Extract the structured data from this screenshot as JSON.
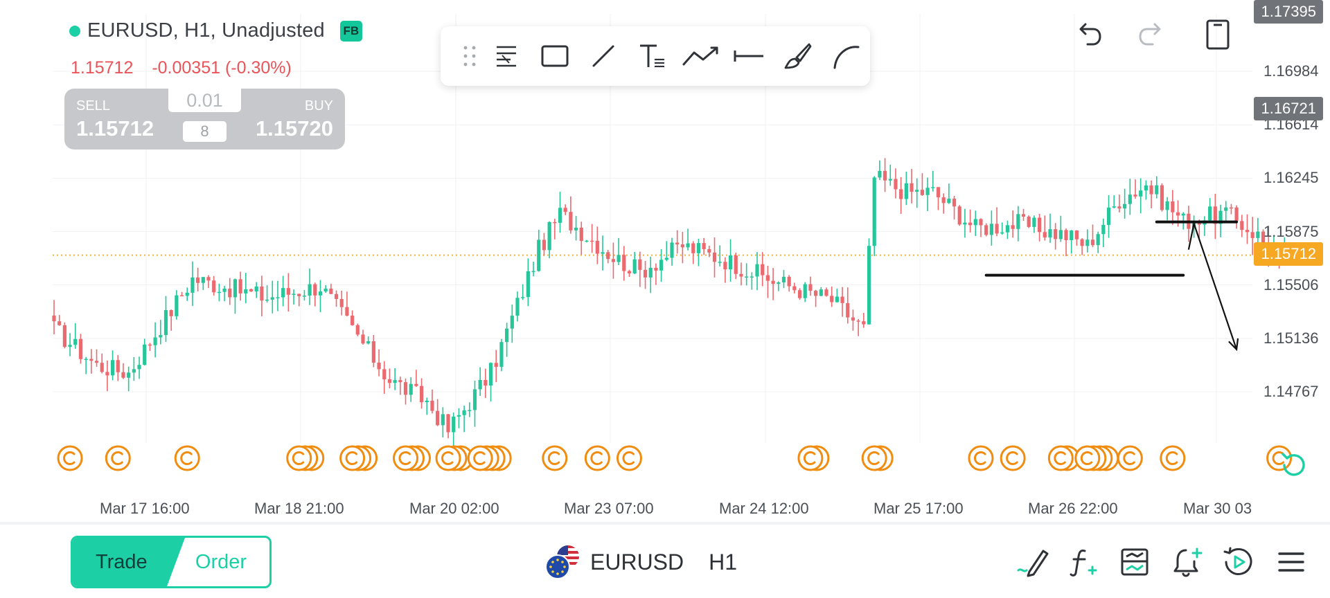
{
  "header": {
    "symbol_title": "EURUSD, H1, Unadjusted",
    "badge": "FB",
    "last_price": "1.15712",
    "change": "-0.00351 (-0.30%)"
  },
  "trade_panel": {
    "sell_label": "SELL",
    "sell_price": "1.15712",
    "buy_label": "BUY",
    "buy_price": "1.15720",
    "lot_value": "0.01",
    "spread": "8"
  },
  "drawing_tools": [
    "grip-icon",
    "fibonacci-icon",
    "rectangle-icon",
    "trendline-icon",
    "text-icon",
    "polyline-icon",
    "horizontal-line-icon",
    "brush-icon",
    "arc-icon"
  ],
  "top_actions": [
    "undo-icon",
    "redo-icon",
    "device-layout-icon"
  ],
  "chart_data": {
    "type": "candlestick",
    "symbol": "EURUSD",
    "timeframe": "H1",
    "price_axis_ticks": [
      "1.16984",
      "1.16614",
      "1.16245",
      "1.15875",
      "1.15506",
      "1.15136",
      "1.14767"
    ],
    "time_axis_ticks": [
      "Mar 17 16:00",
      "Mar 18 21:00",
      "Mar 20 02:00",
      "Mar 23 07:00",
      "Mar 24 12:00",
      "Mar 25 17:00",
      "Mar 26 22:00",
      "Mar 30 03"
    ],
    "ylim": [
      1.1435,
      1.1745
    ],
    "price_tags": [
      {
        "label": "1.17395",
        "color": "#707378"
      },
      {
        "label": "1.16721",
        "color": "#707378"
      },
      {
        "label": "1.15712",
        "color": "#f7a823"
      }
    ],
    "current_price": 1.15712,
    "colors": {
      "up": "#26c69a",
      "down": "#ea6a6f",
      "events": "#f08c10",
      "current_line": "#f3b13a"
    },
    "anchors": [
      {
        "t": 0,
        "p": 1.152
      },
      {
        "t": 8,
        "p": 1.1495
      },
      {
        "t": 14,
        "p": 1.149
      },
      {
        "t": 26,
        "p": 1.1555
      },
      {
        "t": 40,
        "p": 1.1542
      },
      {
        "t": 50,
        "p": 1.155
      },
      {
        "t": 57,
        "p": 1.1515
      },
      {
        "t": 63,
        "p": 1.1485
      },
      {
        "t": 70,
        "p": 1.147
      },
      {
        "t": 74,
        "p": 1.145
      },
      {
        "t": 82,
        "p": 1.149
      },
      {
        "t": 91,
        "p": 1.1575
      },
      {
        "t": 95,
        "p": 1.16
      },
      {
        "t": 105,
        "p": 1.157
      },
      {
        "t": 110,
        "p": 1.156
      },
      {
        "t": 118,
        "p": 1.1578
      },
      {
        "t": 126,
        "p": 1.1568
      },
      {
        "t": 134,
        "p": 1.1555
      },
      {
        "t": 146,
        "p": 1.154
      },
      {
        "t": 152,
        "p": 1.152
      },
      {
        "t": 154,
        "p": 1.1625
      },
      {
        "t": 160,
        "p": 1.1615
      },
      {
        "t": 165,
        "p": 1.1615
      },
      {
        "t": 173,
        "p": 1.159
      },
      {
        "t": 181,
        "p": 1.1593
      },
      {
        "t": 190,
        "p": 1.1585
      },
      {
        "t": 194,
        "p": 1.1578
      },
      {
        "t": 200,
        "p": 1.161
      },
      {
        "t": 205,
        "p": 1.162
      },
      {
        "t": 212,
        "p": 1.1595
      },
      {
        "t": 220,
        "p": 1.16
      },
      {
        "t": 226,
        "p": 1.1585
      },
      {
        "t": 230,
        "p": 1.1568
      },
      {
        "t": 232,
        "p": 1.1571
      }
    ],
    "event_markers": [
      {
        "t": 3,
        "count": 1
      },
      {
        "t": 12,
        "count": 1
      },
      {
        "t": 25,
        "count": 1
      },
      {
        "t": 46,
        "count": 3
      },
      {
        "t": 56,
        "count": 3
      },
      {
        "t": 66,
        "count": 3
      },
      {
        "t": 74,
        "count": 3
      },
      {
        "t": 80,
        "count": 4
      },
      {
        "t": 94,
        "count": 1
      },
      {
        "t": 102,
        "count": 1
      },
      {
        "t": 108,
        "count": 1
      },
      {
        "t": 142,
        "count": 2
      },
      {
        "t": 154,
        "count": 2
      },
      {
        "t": 174,
        "count": 1
      },
      {
        "t": 180,
        "count": 1
      },
      {
        "t": 189,
        "count": 2
      },
      {
        "t": 194,
        "count": 4
      },
      {
        "t": 202,
        "count": 1
      },
      {
        "t": 210,
        "count": 1
      },
      {
        "t": 230,
        "count": 1
      },
      {
        "t": 242,
        "count": 2
      },
      {
        "t": 253,
        "count": 1
      },
      {
        "t": 263,
        "count": 1
      }
    ],
    "drawings": [
      {
        "type": "hline",
        "t1": 207,
        "t2": 222,
        "p": 1.15942
      },
      {
        "type": "hline",
        "t1": 175,
        "t2": 212,
        "p": 1.15573
      },
      {
        "type": "arrow",
        "points": [
          {
            "t": 213,
            "p": 1.1575
          },
          {
            "t": 214,
            "p": 1.1593
          },
          {
            "t": 222,
            "p": 1.1506
          }
        ]
      }
    ]
  },
  "bottom_bar": {
    "trade_label": "Trade",
    "order_label": "Order",
    "symbol": "EURUSD",
    "timeframe": "H1"
  },
  "bottom_icons": [
    "draw-pencil-icon",
    "indicators-icon",
    "templates-icon",
    "alert-icon",
    "replay-icon",
    "menu-icon"
  ]
}
